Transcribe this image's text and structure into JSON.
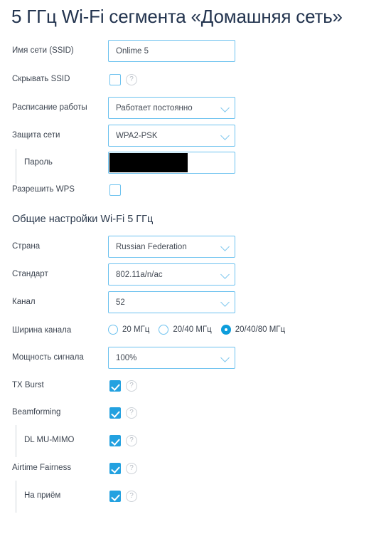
{
  "title": "5 ГГц Wi-Fi сегмента «Домашняя сеть»",
  "section_heading": "Общие настройки Wi-Fi 5 ГГц",
  "icons": {
    "help": "?",
    "chevron": "chevron-down-icon"
  },
  "colors": {
    "accent": "#23a1e0",
    "field_border": "#6dc2ef",
    "title": "#23344f",
    "label": "#3c4450"
  },
  "rows": {
    "ssid": {
      "label": "Имя сети (SSID)",
      "value": "Onlime 5"
    },
    "hide_ssid": {
      "label": "Скрывать SSID",
      "checked": false
    },
    "schedule": {
      "label": "Расписание работы",
      "value": "Работает постоянно"
    },
    "security": {
      "label": "Защита сети",
      "value": "WPA2-PSK"
    },
    "password": {
      "label": "Пароль",
      "value": ""
    },
    "wps": {
      "label": "Разрешить WPS",
      "checked": false
    },
    "country": {
      "label": "Страна",
      "value": "Russian Federation"
    },
    "standard": {
      "label": "Стандарт",
      "value": "802.11a/n/ac"
    },
    "channel": {
      "label": "Канал",
      "value": "52"
    },
    "channel_width": {
      "label": "Ширина канала",
      "options": [
        "20 МГц",
        "20/40 МГц",
        "20/40/80 МГц"
      ],
      "selected_index": 2
    },
    "signal_power": {
      "label": "Мощность сигнала",
      "value": "100%"
    },
    "tx_burst": {
      "label": "TX Burst",
      "checked": true
    },
    "beamforming": {
      "label": "Beamforming",
      "checked": true
    },
    "dl_mu_mimo": {
      "label": "DL MU-MIMO",
      "checked": true
    },
    "airtime_fairness": {
      "label": "Airtime Fairness",
      "checked": true
    },
    "on_receive": {
      "label": "На приём",
      "checked": true
    }
  }
}
